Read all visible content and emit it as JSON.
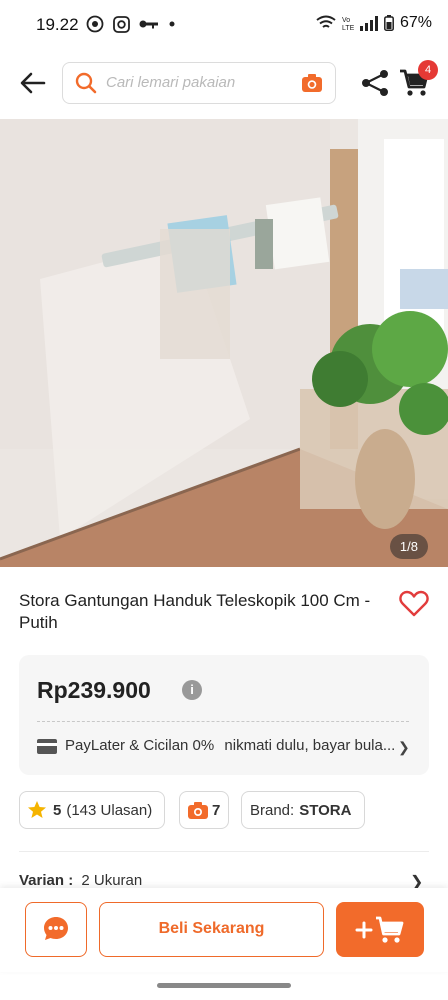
{
  "status_bar": {
    "time": "19.22",
    "battery": "67%"
  },
  "header": {
    "search_placeholder": "Cari lemari pakaian",
    "cart_count": "4"
  },
  "product": {
    "image_counter": "1/8",
    "title": "Stora Gantungan Handuk Teleskopik 100 Cm - Putih",
    "price": "Rp239.900",
    "paylater_label": "PayLater & Cicilan 0%",
    "paylater_desc": "nikmati dulu, bayar bula...",
    "rating": "5",
    "reviews": "(143 Ulasan)",
    "photo_count": "7",
    "brand_label": "Brand:",
    "brand_value": "STORA",
    "variant_label": "Varian :",
    "variant_value": "2 Ukuran"
  },
  "actions": {
    "buy_now": "Beli Sekarang"
  },
  "colors": {
    "accent": "#f26b2b",
    "badge": "#e53935"
  },
  "icons": [
    "back-arrow-icon",
    "search-icon",
    "camera-icon",
    "share-icon",
    "cart-icon",
    "heart-icon",
    "info-icon",
    "card-icon",
    "star-icon",
    "chevron-right-icon",
    "chat-icon",
    "add-to-cart-icon"
  ]
}
